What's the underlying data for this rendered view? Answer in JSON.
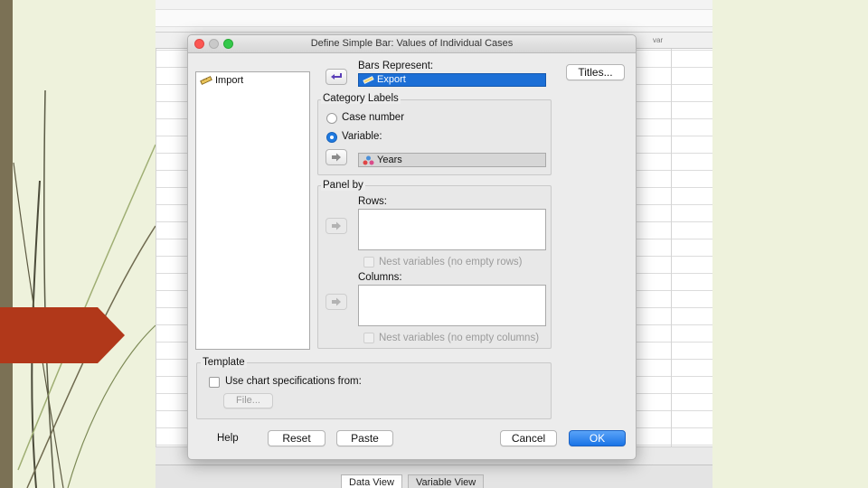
{
  "dialog": {
    "title": "Define Simple Bar: Values of Individual Cases",
    "source_variables": [
      {
        "name": "Import",
        "icon": "scale-ruler-icon"
      }
    ],
    "bars_represent": {
      "label": "Bars Represent:",
      "value": "Export",
      "icon": "scale-ruler-icon"
    },
    "titles_button": "Titles...",
    "category_labels": {
      "title": "Category Labels",
      "case_number": "Case number",
      "variable": "Variable:",
      "selected": "variable",
      "variable_value": "Years",
      "variable_icon": "nominal-variable-icon"
    },
    "panel_by": {
      "title": "Panel by",
      "rows_label": "Rows:",
      "nest_rows": "Nest variables (no empty rows)",
      "columns_label": "Columns:",
      "nest_columns": "Nest variables (no empty columns)"
    },
    "template": {
      "title": "Template",
      "use_chart_spec": "Use chart specifications from:",
      "file_button": "File..."
    },
    "buttons": {
      "help": "Help",
      "reset": "Reset",
      "paste": "Paste",
      "cancel": "Cancel",
      "ok": "OK"
    }
  },
  "background": {
    "column_header": "var",
    "tabs": {
      "data_view": "Data View",
      "variable_view": "Variable View"
    }
  },
  "colors": {
    "slide_accent": "#b1381a",
    "slide_stripe": "#7b7155",
    "selection_blue": "#1c6fd6",
    "ok_button": "#1a74e6"
  }
}
